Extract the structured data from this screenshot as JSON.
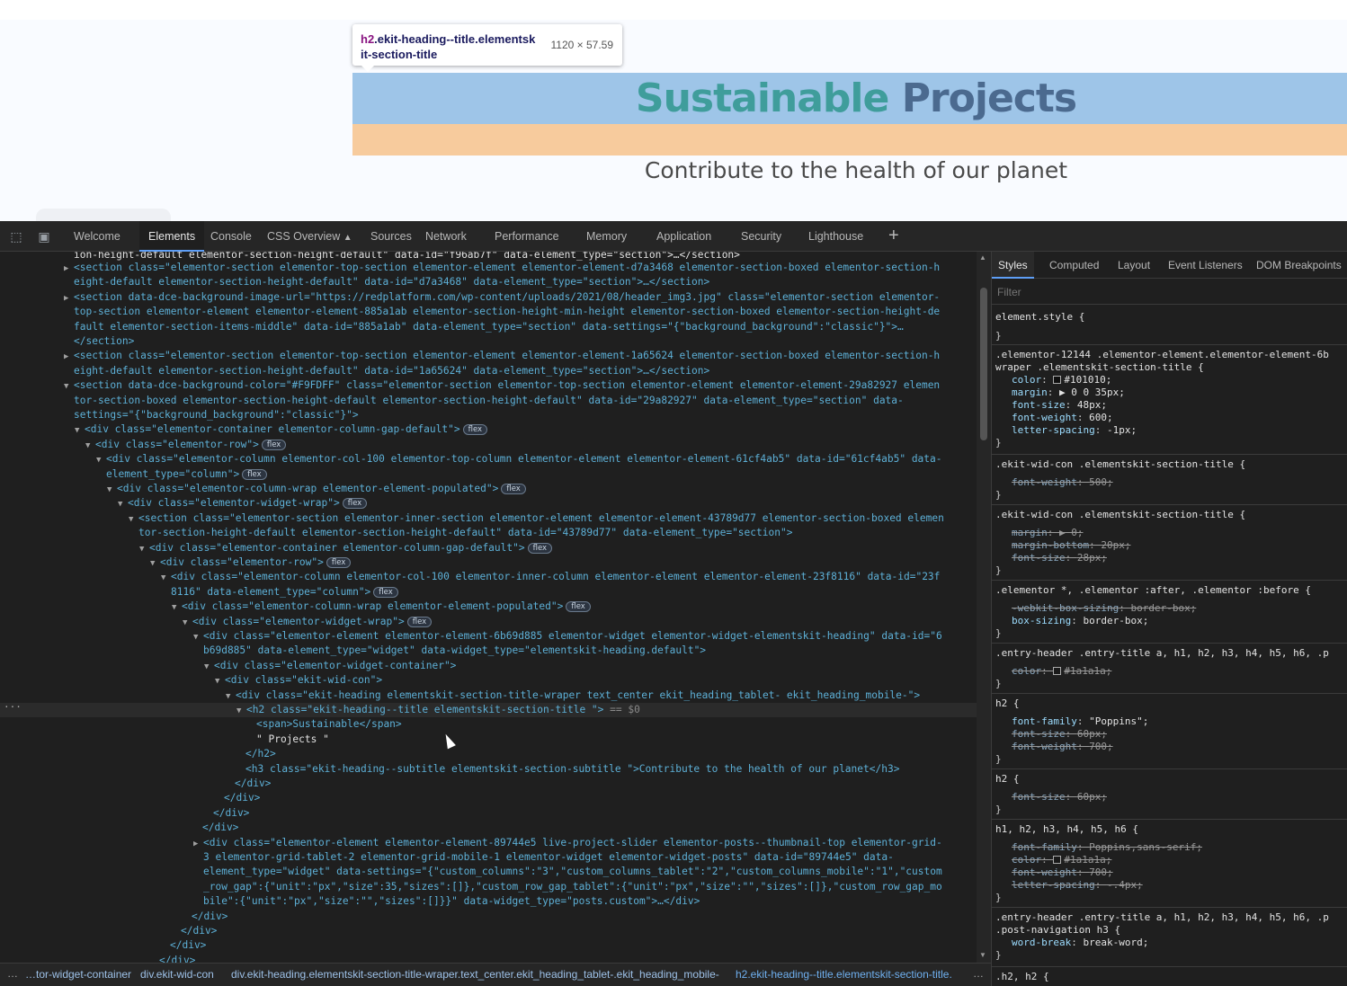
{
  "webpage": {
    "title_word1": "Sustainable",
    "title_word2": "Projects",
    "subtitle": "Contribute to the health of our planet",
    "tooltip": {
      "tag": "h2",
      "classes": ".ekit-heading--title.elementsk it-section-title",
      "dims": "1120 × 57.59"
    },
    "colors": {
      "title_teal": "#3f9d9b",
      "title_slate": "#4b6a8f",
      "highlight_content": "#6fa8dc",
      "highlight_margin": "#f6b26b"
    }
  },
  "devtools": {
    "icons": [
      "inspect-icon",
      "device-toggle-icon"
    ],
    "tabs": [
      "Welcome",
      "Elements",
      "Console",
      "CSS Overview",
      "Sources",
      "Network",
      "Performance",
      "Memory",
      "Application",
      "Security",
      "Lighthouse"
    ],
    "active_tab": "Elements",
    "styles_tabs": [
      "Styles",
      "Computed",
      "Layout",
      "Event Listeners",
      "DOM Breakpoints"
    ],
    "filter_placeholder": "Filter",
    "breadcrumbs": [
      "…tor-widget-container",
      "div.ekit-wid-con",
      "div.ekit-heading.elementskit-section-title-wraper.text_center.ekit_heading_tablet-.ekit_heading_mobile-",
      "h2.ekit-heading--title.elementskit-section-title."
    ],
    "badge_label": "flex",
    "selected_marker": "== $0",
    "tree_text": {
      "l0": "ion-height-default elementor-section-height-default\" data-id=\"f96ab7f\" data-element_type=\"section\">…</section>",
      "l1a": "<section class=\"elementor-section elementor-top-section elementor-element elementor-element-d7a3468 elementor-section-boxed elementor-section-h",
      "l1b": "eight-default elementor-section-height-default\" data-id=\"d7a3468\" data-element_type=\"section\">…</section>",
      "l2a": "<section data-dce-background-image-url=\"https://redplatform.com/wp-content/uploads/2021/08/header_img3.jpg\" class=\"elementor-section elementor-",
      "l2b": "top-section elementor-element elementor-element-885a1ab elementor-section-height-min-height elementor-section-boxed elementor-section-height-de",
      "l2c": "fault elementor-section-items-middle\" data-id=\"885a1ab\" data-element_type=\"section\" data-settings=\"{\"background_background\":\"classic\"}\">…",
      "l2d": "</section>",
      "l3a": "<section class=\"elementor-section elementor-top-section elementor-element elementor-element-1a65624 elementor-section-boxed elementor-section-h",
      "l3b": "eight-default elementor-section-height-default\" data-id=\"1a65624\" data-element_type=\"section\">…</section>",
      "l4a": "<section data-dce-background-color=\"#F9FDFF\" class=\"elementor-section elementor-top-section elementor-element elementor-element-29a82927 elemen",
      "l4b": "tor-section-boxed elementor-section-height-default elementor-section-height-default\" data-id=\"29a82927\" data-element_type=\"section\" data-",
      "l4c": "settings=\"{\"background_background\":\"classic\"}\">",
      "l5": "<div class=\"elementor-container elementor-column-gap-default\">",
      "l6": "<div class=\"elementor-row\">",
      "l7a": "<div class=\"elementor-column elementor-col-100 elementor-top-column elementor-element elementor-element-61cf4ab5\" data-id=\"61cf4ab5\" data-",
      "l7b": "element_type=\"column\">",
      "l8": "<div class=\"elementor-column-wrap elementor-element-populated\">",
      "l9": "<div class=\"elementor-widget-wrap\">",
      "l10a": "<section class=\"elementor-section elementor-inner-section elementor-element elementor-element-43789d77 elementor-section-boxed elemen",
      "l10b": "tor-section-height-default elementor-section-height-default\" data-id=\"43789d77\" data-element_type=\"section\">",
      "l11": "<div class=\"elementor-container elementor-column-gap-default\">",
      "l12": "<div class=\"elementor-row\">",
      "l13a": "<div class=\"elementor-column elementor-col-100 elementor-inner-column elementor-element elementor-element-23f8116\" data-id=\"23f",
      "l13b": "8116\" data-element_type=\"column\">",
      "l14": "<div class=\"elementor-column-wrap elementor-element-populated\">",
      "l15": "<div class=\"elementor-widget-wrap\">",
      "l16a": "<div class=\"elementor-element elementor-element-6b69d885 elementor-widget elementor-widget-elementskit-heading\" data-id=\"6",
      "l16b": "b69d885\" data-element_type=\"widget\" data-widget_type=\"elementskit-heading.default\">",
      "l17": "<div class=\"elementor-widget-container\">",
      "l18": "<div class=\"ekit-wid-con\">",
      "l19": "<div class=\"ekit-heading elementskit-section-title-wraper text_center   ekit_heading_tablet-   ekit_heading_mobile-\">",
      "l20": "<h2 class=\"ekit-heading--title elementskit-section-title \">",
      "l21": "<span>Sustainable</span>",
      "l22": "\" Projects \"",
      "l23": "</h2>",
      "l24": "<h3 class=\"ekit-heading--subtitle elementskit-section-subtitle  \">Contribute to the health of our planet</h3>",
      "l25": "</div>",
      "l26": "</div>",
      "l27": "</div>",
      "l28": "</div>",
      "l29a": "<div class=\"elementor-element elementor-element-89744e5 live-project-slider elementor-posts--thumbnail-top elementor-grid-",
      "l29b": "3 elementor-grid-tablet-2 elementor-grid-mobile-1 elementor-widget elementor-widget-posts\" data-id=\"89744e5\" data-",
      "l29c": "element_type=\"widget\" data-settings=\"{\"custom_columns\":\"3\",\"custom_columns_tablet\":\"2\",\"custom_columns_mobile\":\"1\",\"custom",
      "l29d": "_row_gap\":{\"unit\":\"px\",\"size\":35,\"sizes\":[]},\"custom_row_gap_tablet\":{\"unit\":\"px\",\"size\":\"\",\"sizes\":[]},\"custom_row_gap_mo",
      "l29e": "bile\":{\"unit\":\"px\",\"size\":\"\",\"sizes\":[]}}\" data-widget_type=\"posts.custom\">…</div>",
      "l30": "</div>",
      "l31": "</div>",
      "l32": "</div>",
      "l33": "</div>"
    },
    "styles": {
      "r0_sel": "element.style {",
      "r1_sel_a": ".elementor-12144 .elementor-element.elementor-element-6b",
      "r1_sel_b": "wraper .elementskit-section-title {",
      "r1_color_v": "#101010;",
      "r1_margin_v": "▶ 0 0 35px;",
      "r1_fs_v": "48px;",
      "r1_fw_v": "600;",
      "r1_ls_v": "-1px;",
      "r2_sel": ".ekit-wid-con .elementskit-section-title {",
      "r2_fw_v": "500;",
      "r3_sel": ".ekit-wid-con .elementskit-section-title {",
      "r3_margin_v": "▶ 0;",
      "r3_mb_v": "20px;",
      "r3_fs_v": "28px;",
      "r4_sel": ".elementor *, .elementor :after, .elementor :before {",
      "r4_wbs_v": "border-box;",
      "r4_bs_v": "border-box;",
      "r5_sel": ".entry-header .entry-title a, h1, h2, h3, h4, h5, h6, .p",
      "r5_color_v": "#1a1a1a;",
      "r6_sel": "h2 {",
      "r6_ff_v": "\"Poppins\";",
      "r6_fs_v": "60px;",
      "r6_fw_v": "700;",
      "r7_sel": "h2 {",
      "r7_fs_v": "60px;",
      "r8_sel": "h1, h2, h3, h4, h5, h6 {",
      "r8_ff_v": "Poppins,sans-serif;",
      "r8_color_v": "#1a1a1a;",
      "r8_fw_v": "700;",
      "r8_ls_v": "-.4px;",
      "r9_sel_a": ".entry-header .entry-title a, h1, h2, h3, h4, h5, h6, .p",
      "r9_sel_b": ".post-navigation h3 {",
      "r9_wb_v": "break-word;",
      "r10_sel": ".h2, h2 {",
      "close": "}",
      "p_color": "color",
      "p_margin": "margin",
      "p_font_size": "font-size",
      "p_font_weight": "font-weight",
      "p_letter_spacing": "letter-spacing",
      "p_margin_bottom": "margin-bottom",
      "p_webkit_box_sizing": "-webkit-box-sizing",
      "p_box_sizing": "box-sizing",
      "p_font_family": "font-family",
      "p_word_break": "word-break"
    }
  }
}
